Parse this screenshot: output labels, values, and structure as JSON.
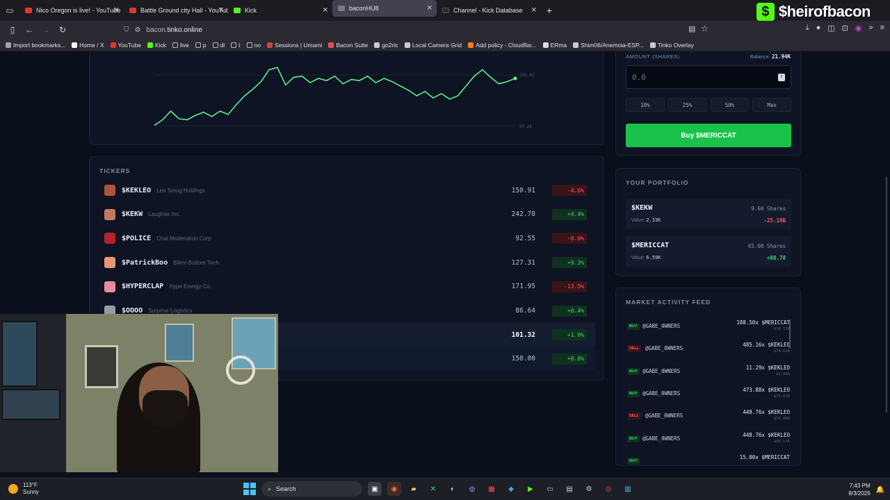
{
  "browser": {
    "tabs": [
      {
        "title": "Nico Oregon is live! - YouTube",
        "favicon": "youtube-icon"
      },
      {
        "title": "Battle Ground city Hall - YouTube",
        "favicon": "youtube-icon"
      },
      {
        "title": "Kick",
        "favicon": "kick-icon"
      },
      {
        "title": "baconHU8",
        "favicon": "page-icon"
      },
      {
        "title": "Channel - Kick Database",
        "favicon": "page-icon"
      }
    ],
    "url_prefix": "bacon.",
    "url_host": "tinko.online",
    "bookmarks": [
      "Import bookmarks...",
      "Home / X",
      "YouTube",
      "Kick",
      "live",
      "p",
      "dl",
      "t",
      "no",
      "Sessions | Umami",
      "Bacon Suite",
      "go2rtc",
      "Local Camera Grid",
      "Add policy - Cloudflar...",
      "ERma",
      "Shim06/Anemoia-ESP...",
      "Tinko Overlay"
    ],
    "overlay_brand": "$heirofbacon"
  },
  "chart": {
    "y_high_label": "101.91",
    "y_low_label": "97.26"
  },
  "chart_data": {
    "type": "line",
    "ylim": [
      97.26,
      101.91
    ],
    "values": [
      97.3,
      97.8,
      98.6,
      97.9,
      97.8,
      98.2,
      98.5,
      98.1,
      98.6,
      98.3,
      99.2,
      100.0,
      100.6,
      101.3,
      102.4,
      102.6,
      101.0,
      101.7,
      101.8,
      101.2,
      101.6,
      101.4,
      101.8,
      101.1,
      101.5,
      101.4,
      101.8,
      101.2,
      101.6,
      101.3,
      100.9,
      100.5,
      100.0,
      100.4,
      99.8,
      100.2,
      99.7,
      100.0,
      100.9,
      101.8,
      102.4,
      101.7,
      101.1,
      101.3,
      101.6
    ]
  },
  "tickers": {
    "title": "TICKERS",
    "rows": [
      {
        "symbol": "$KEKLEO",
        "name": "Leo Smug Holdings",
        "price": "150.91",
        "change": "-4.6%",
        "dir": "down",
        "color": "#b2543c"
      },
      {
        "symbol": "$KEKW",
        "name": "Laughter Inc.",
        "price": "242.78",
        "change": "+4.4%",
        "dir": "up",
        "color": "#c47a5d"
      },
      {
        "symbol": "$POLICE",
        "name": "Chat Moderation Corp",
        "price": "92.55",
        "change": "-0.0%",
        "dir": "down",
        "color": "#b8202a"
      },
      {
        "symbol": "$PatrickBoo",
        "name": "Bikini Bottom Tech",
        "price": "127.31",
        "change": "+9.3%",
        "dir": "up",
        "color": "#e8967a"
      },
      {
        "symbol": "$HYPERCLAP",
        "name": "Hype Energy Co.",
        "price": "171.95",
        "change": "-13.5%",
        "dir": "down",
        "color": "#e88aa0"
      },
      {
        "symbol": "$OOOO",
        "name": "Surprise Logistics",
        "price": "86.64",
        "change": "+0.4%",
        "dir": "up",
        "color": "#9a9aa2"
      },
      {
        "symbol": "",
        "name": "",
        "price": "101.32",
        "change": "+1.0%",
        "dir": "up",
        "color": "#0e1424"
      },
      {
        "symbol": "",
        "name": "",
        "price": "150.00",
        "change": "+0.0%",
        "dir": "up",
        "color": "#0e1424"
      }
    ]
  },
  "trade": {
    "amount_label": "AMOUNT (SHARES)",
    "balance_label": "Balance:",
    "balance_value": "21.94K",
    "amount_placeholder": "0.0",
    "pct_buttons": [
      "10%",
      "25%",
      "50%",
      "Max"
    ],
    "buy_label": "Buy $MERICCAT"
  },
  "portfolio": {
    "title": "YOUR PORTFOLIO",
    "items": [
      {
        "symbol": "$KEKW",
        "value_label": "Value:",
        "value": "2.33K",
        "shares": "9.60 Shares",
        "pl": "-25.19B",
        "dir": "down"
      },
      {
        "symbol": "$MERICCAT",
        "value_label": "Value:",
        "value": "6.59K",
        "shares": "65.00 Shares",
        "pl": "+80.78",
        "dir": "up"
      }
    ]
  },
  "feed": {
    "title": "MARKET ACTIVITY FEED",
    "items": [
      {
        "side": "BUY",
        "user": "@GABE_0WNERS",
        "amount": "188.50x $MERICCAT",
        "value": "$19.51K"
      },
      {
        "side": "SELL",
        "user": "@GABE_0WNERS",
        "amount": "485.16x $KEKLEO",
        "value": "$74.62K"
      },
      {
        "side": "BUY",
        "user": "@GABE_0WNERS",
        "amount": "11.29x $KEKLEO",
        "value": "$1.84K"
      },
      {
        "side": "BUY",
        "user": "@GABE_0WNERS",
        "amount": "473.88x $KEKLEO",
        "value": "$73.61K"
      },
      {
        "side": "SELL",
        "user": "@GABE_0WNERS",
        "amount": "448.76x $KEKLEO",
        "value": "$70.86K"
      },
      {
        "side": "BUY",
        "user": "@GABE_0WNERS",
        "amount": "448.76x $KEKLEO",
        "value": "$68.51K"
      },
      {
        "side": "BUY",
        "user": "",
        "amount": "15.00x $MERICCAT",
        "value": ""
      }
    ]
  },
  "taskbar": {
    "temp": "113°F",
    "condition": "Sunny",
    "search": "Search",
    "time": "7:43 PM",
    "date": "8/3/2026"
  }
}
